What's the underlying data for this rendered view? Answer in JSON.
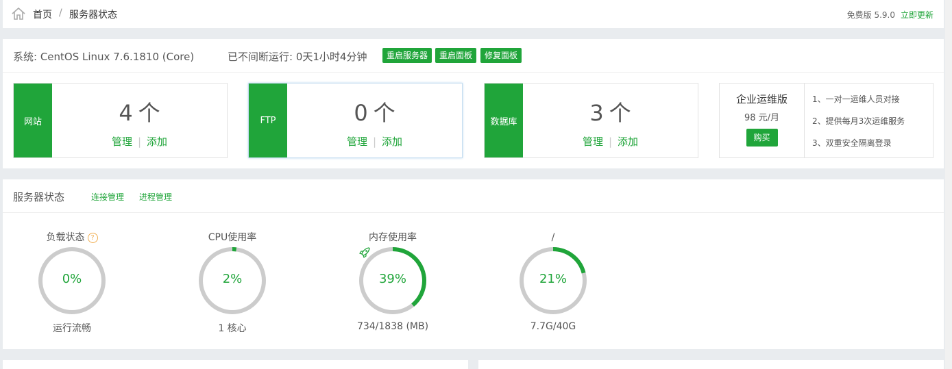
{
  "breadcrumb": {
    "home": "首页",
    "separator": "/",
    "current": "服务器状态"
  },
  "version": {
    "label": "免费版 5.9.0",
    "update": "立即更新"
  },
  "system": {
    "os": "系统: CentOS Linux 7.6.1810 (Core)",
    "uptime": "已不间断运行: 0天1小时4分钟",
    "buttons": [
      "重启服务器",
      "重启面板",
      "修复面板"
    ]
  },
  "stats": [
    {
      "tag": "网站",
      "count": "4",
      "unit": "个",
      "manage": "管理",
      "add": "添加"
    },
    {
      "tag": "FTP",
      "count": "0",
      "unit": "个",
      "manage": "管理",
      "add": "添加"
    },
    {
      "tag": "数据库",
      "count": "3",
      "unit": "个",
      "manage": "管理",
      "add": "添加"
    }
  ],
  "enterprise": {
    "title": "企业运维版",
    "price": "98 元/月",
    "buy": "购买",
    "features": [
      "1、一对一运维人员对接",
      "2、提供每月3次运维服务",
      "3、双重安全隔离登录"
    ]
  },
  "server_status": {
    "title": "服务器状态",
    "links": [
      "连接管理",
      "进程管理"
    ],
    "gauges": [
      {
        "title": "负载状态",
        "help": "?",
        "value": "0%",
        "percent": 0,
        "sub": "运行流畅",
        "icon": "help-icon"
      },
      {
        "title": "CPU使用率",
        "value": "2%",
        "percent": 2,
        "sub": "1 核心"
      },
      {
        "title": "内存使用率",
        "value": "39%",
        "percent": 39,
        "sub": "734/1838 (MB)",
        "icon": "rocket-icon"
      },
      {
        "title": "/",
        "value": "21%",
        "percent": 21,
        "sub": "7.7G/40G"
      }
    ]
  },
  "colors": {
    "accent": "#20a53a",
    "track": "#cccccc",
    "warning": "#f0ad4e"
  }
}
